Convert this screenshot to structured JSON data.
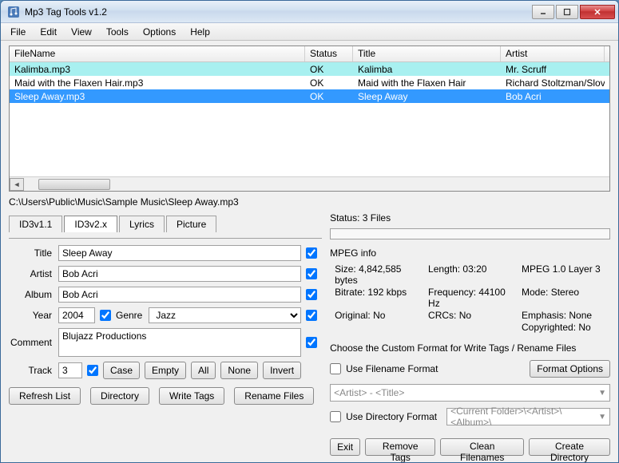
{
  "window": {
    "title": "Mp3 Tag Tools v1.2"
  },
  "menu": {
    "items": [
      "File",
      "Edit",
      "View",
      "Tools",
      "Options",
      "Help"
    ]
  },
  "filelist": {
    "headers": [
      "FileName",
      "Status",
      "Title",
      "Artist"
    ],
    "rows": [
      {
        "filename": "Kalimba.mp3",
        "status": "OK",
        "title": "Kalimba",
        "artist": "Mr. Scruff",
        "highlight": true
      },
      {
        "filename": "Maid with the Flaxen Hair.mp3",
        "status": "OK",
        "title": "Maid with the Flaxen Hair",
        "artist": "Richard Stoltzman/Slovak"
      },
      {
        "filename": "Sleep Away.mp3",
        "status": "OK",
        "title": "Sleep Away",
        "artist": "Bob Acri",
        "selected": true
      }
    ]
  },
  "path": "C:\\Users\\Public\\Music\\Sample Music\\Sleep Away.mp3",
  "tabs": {
    "items": [
      "ID3v1.1",
      "ID3v2.x",
      "Lyrics",
      "Picture"
    ],
    "active": 1
  },
  "fields": {
    "title_label": "Title",
    "title": "Sleep Away",
    "artist_label": "Artist",
    "artist": "Bob Acri",
    "album_label": "Album",
    "album": "Bob Acri",
    "year_label": "Year",
    "year": "2004",
    "genre_label": "Genre",
    "genre": "Jazz",
    "comment_label": "Comment",
    "comment": "Blujazz Productions",
    "track_label": "Track",
    "track": "3"
  },
  "trackbtns": {
    "case": "Case",
    "empty": "Empty",
    "all": "All",
    "none": "None",
    "invert": "Invert"
  },
  "leftbuttons": {
    "refresh": "Refresh List",
    "directory": "Directory",
    "writetags": "Write Tags",
    "rename": "Rename Files"
  },
  "right": {
    "status_label": "Status: 3 Files",
    "mpeg_head": "MPEG info",
    "mpeg": {
      "size": "Size: 4,842,585 bytes",
      "length": "Length:  03:20",
      "mpeg": "MPEG 1.0 Layer 3",
      "bitrate": "Bitrate: 192 kbps",
      "freq": "Frequency: 44100 Hz",
      "mode": "Mode: Stereo",
      "original": "Original: No",
      "crcs": "CRCs: No",
      "emphasis": "Emphasis: None",
      "copyright": "Copyrighted: No"
    },
    "custom_head": "Choose the Custom Format for Write Tags / Rename Files",
    "use_filename": "Use Filename Format",
    "format_options": "Format Options",
    "filename_combo": "<Artist> - <Title>",
    "use_directory": "Use Directory Format",
    "directory_combo": "<Current Folder>\\<Artist>\\<Album>\\",
    "btns": {
      "exit": "Exit",
      "remove": "Remove Tags",
      "clean": "Clean Filenames",
      "createdir": "Create Directory"
    }
  }
}
